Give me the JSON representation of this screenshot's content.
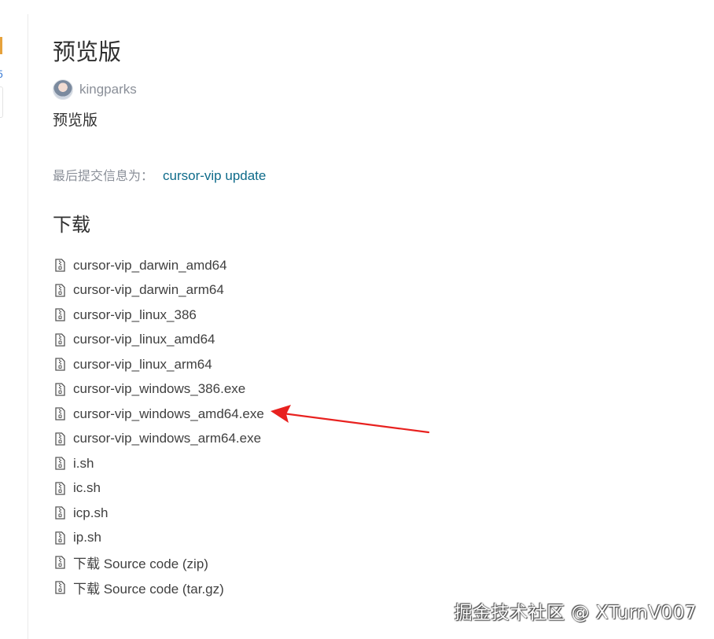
{
  "left_fragment": {
    "digit": "5"
  },
  "release": {
    "title": "预览版",
    "author": "kingparks",
    "description": "预览版",
    "commit_label": "最后提交信息为：",
    "commit_message": "cursor-vip update"
  },
  "downloads": {
    "heading": "下载",
    "icon": "file-zip-icon",
    "files": [
      "cursor-vip_darwin_amd64",
      "cursor-vip_darwin_arm64",
      "cursor-vip_linux_386",
      "cursor-vip_linux_amd64",
      "cursor-vip_linux_arm64",
      "cursor-vip_windows_386.exe",
      "cursor-vip_windows_amd64.exe",
      "cursor-vip_windows_arm64.exe",
      "i.sh",
      "ic.sh",
      "icp.sh",
      "ip.sh",
      "下载 Source code (zip)",
      "下载 Source code (tar.gz)"
    ]
  },
  "annotation": {
    "arrow_color": "#e8211f"
  },
  "watermark": "掘金技术社区 @ XTurnV007"
}
